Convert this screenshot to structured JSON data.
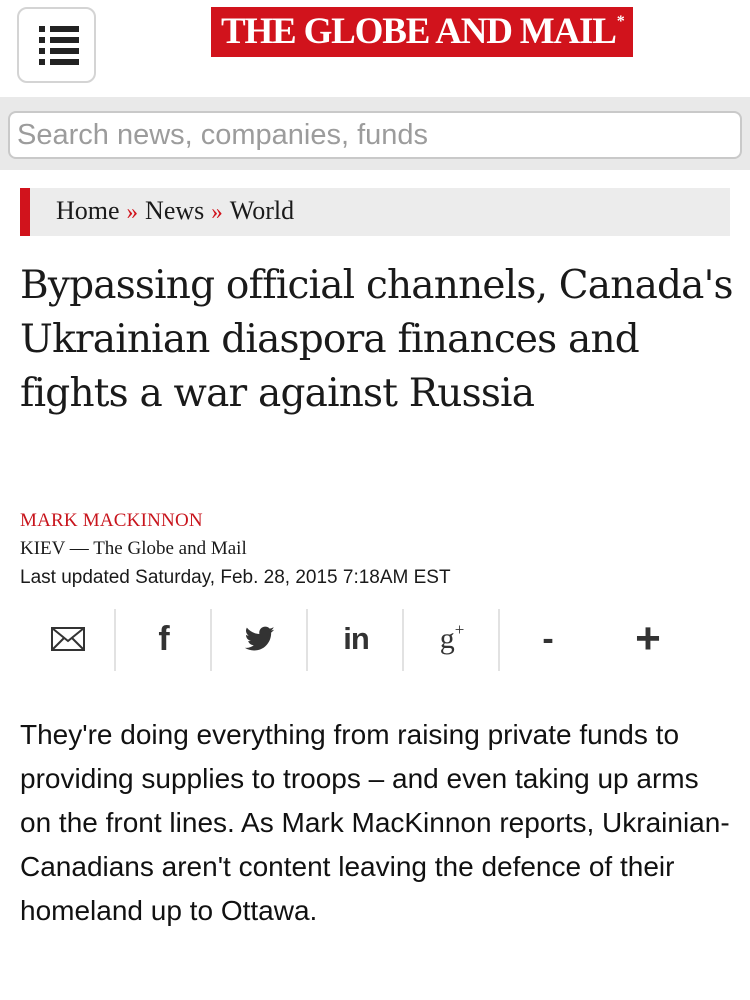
{
  "header": {
    "logo_text": "THE GLOBE AND MAIL",
    "logo_mark": "*",
    "brand_color": "#d1131c",
    "menu_icon": "menu-icon"
  },
  "search": {
    "placeholder": "Search news, companies, funds",
    "value": ""
  },
  "breadcrumb": {
    "items": [
      "Home",
      "News",
      "World"
    ],
    "separator": "»"
  },
  "article": {
    "headline": "Bypassing official channels, Canada's Ukrainian diaspora finances and fights a war against Russia",
    "author": "MARK MACKINNON",
    "dateline": "KIEV — The Globe and Mail",
    "updated": "Last updated Saturday, Feb. 28, 2015 7:18AM EST",
    "summary": "They're doing everything from raising private funds to providing supplies to troops – and even taking up arms on the front lines. As Mark MacKinnon reports, Ukrainian-Canadians aren't content leaving the defence of their homeland up to Ottawa."
  },
  "share": {
    "items": [
      {
        "name": "email",
        "icon": "email-icon",
        "label": ""
      },
      {
        "name": "facebook",
        "icon": "facebook-icon",
        "label": "f"
      },
      {
        "name": "twitter",
        "icon": "twitter-icon",
        "label": ""
      },
      {
        "name": "linkedin",
        "icon": "linkedin-icon",
        "label": "in"
      },
      {
        "name": "google-plus",
        "icon": "google-plus-icon",
        "label": "g",
        "sup": "+"
      },
      {
        "name": "decrease-text",
        "icon": "minus-icon",
        "label": "-"
      },
      {
        "name": "increase-text",
        "icon": "plus-icon",
        "label": "+"
      }
    ]
  },
  "colors": {
    "accent": "#d1131c",
    "author": "#c8151d",
    "breadcrumb_bg": "#ececec",
    "search_band_bg": "#e9e9e9"
  }
}
